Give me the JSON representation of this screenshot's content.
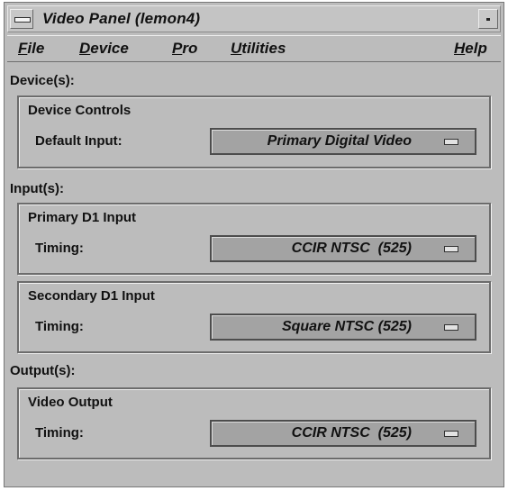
{
  "window": {
    "title": "Video Panel (lemon4)"
  },
  "menu": {
    "file": {
      "m": "F",
      "r": "ile"
    },
    "device": {
      "m": "D",
      "r": "evice"
    },
    "pro": {
      "m": "P",
      "r": "ro"
    },
    "utilities": {
      "m": "U",
      "r": "tilities"
    },
    "help": {
      "m": "H",
      "r": "elp"
    }
  },
  "devices": {
    "section_label": "Device(s):",
    "group_title": "Device Controls",
    "row_label": "Default Input:",
    "value": "Primary Digital Video"
  },
  "inputs": {
    "section_label": "Input(s):",
    "primary": {
      "group_title": "Primary D1 Input",
      "row_label": "Timing:",
      "value": "CCIR NTSC  (525)"
    },
    "secondary": {
      "group_title": "Secondary D1 Input",
      "row_label": "Timing:",
      "value": "Square NTSC (525)"
    }
  },
  "outputs": {
    "section_label": "Output(s):",
    "video": {
      "group_title": "Video Output",
      "row_label": "Timing:",
      "value": "CCIR NTSC  (525)"
    }
  },
  "icons": {
    "window_menu": "window-menu-icon",
    "minimize": "minimize-icon",
    "option_indicator": "option-menu-indicator-icon"
  },
  "colors": {
    "window_bg": "#bcbcbc",
    "option_bg": "#a3a3a3",
    "border": "#6c6c6c"
  }
}
